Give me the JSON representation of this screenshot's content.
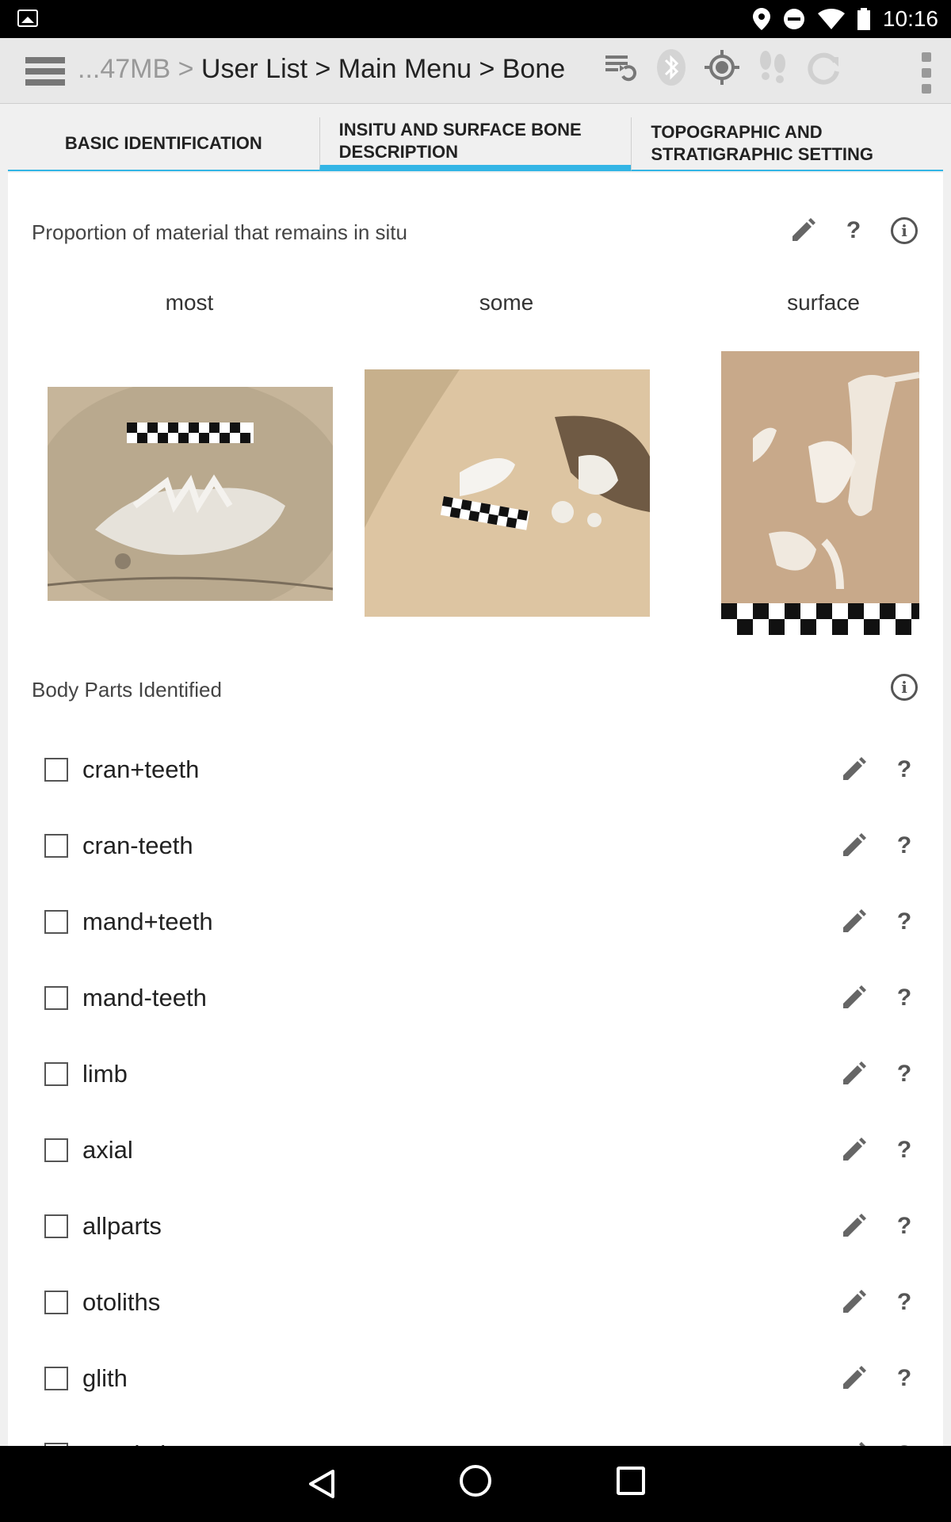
{
  "status_bar": {
    "time": "10:16",
    "icons": [
      "gallery-icon",
      "location-icon",
      "do-not-disturb-icon",
      "wifi-icon",
      "battery-icon"
    ]
  },
  "app_bar": {
    "breadcrumb_muted": "...47MB >",
    "breadcrumb": "User List > Main Menu > Bone",
    "icons": [
      "sync-list-icon",
      "bluetooth-icon",
      "gps-icon",
      "footsteps-icon",
      "refresh-icon",
      "overflow-menu-icon"
    ]
  },
  "tabs": [
    {
      "label": "BASIC IDENTIFICATION",
      "active": false
    },
    {
      "label": "INSITU AND SURFACE BONE DESCRIPTION",
      "active": true
    },
    {
      "label": "TOPOGRAPHIC AND STRATIGRAPHIC SETTING",
      "active": false
    }
  ],
  "proportion": {
    "title": "Proportion of material that remains in situ",
    "options": [
      {
        "label": "most"
      },
      {
        "label": "some"
      },
      {
        "label": "surface"
      }
    ]
  },
  "body_parts": {
    "title": "Body Parts Identified",
    "items": [
      {
        "label": "cran+teeth",
        "checked": false
      },
      {
        "label": "cran-teeth",
        "checked": false
      },
      {
        "label": "mand+teeth",
        "checked": false
      },
      {
        "label": "mand-teeth",
        "checked": false
      },
      {
        "label": "limb",
        "checked": false
      },
      {
        "label": "axial",
        "checked": false
      },
      {
        "label": "allparts",
        "checked": false
      },
      {
        "label": "otoliths",
        "checked": false
      },
      {
        "label": "glith",
        "checked": false
      },
      {
        "label": "exoskel",
        "checked": false
      }
    ]
  },
  "colors": {
    "accent": "#33b5e5",
    "app_bar": "#e8e8e8",
    "text": "#222222"
  },
  "nav_bar": {
    "icons": [
      "back-icon",
      "home-icon",
      "recents-icon"
    ]
  }
}
